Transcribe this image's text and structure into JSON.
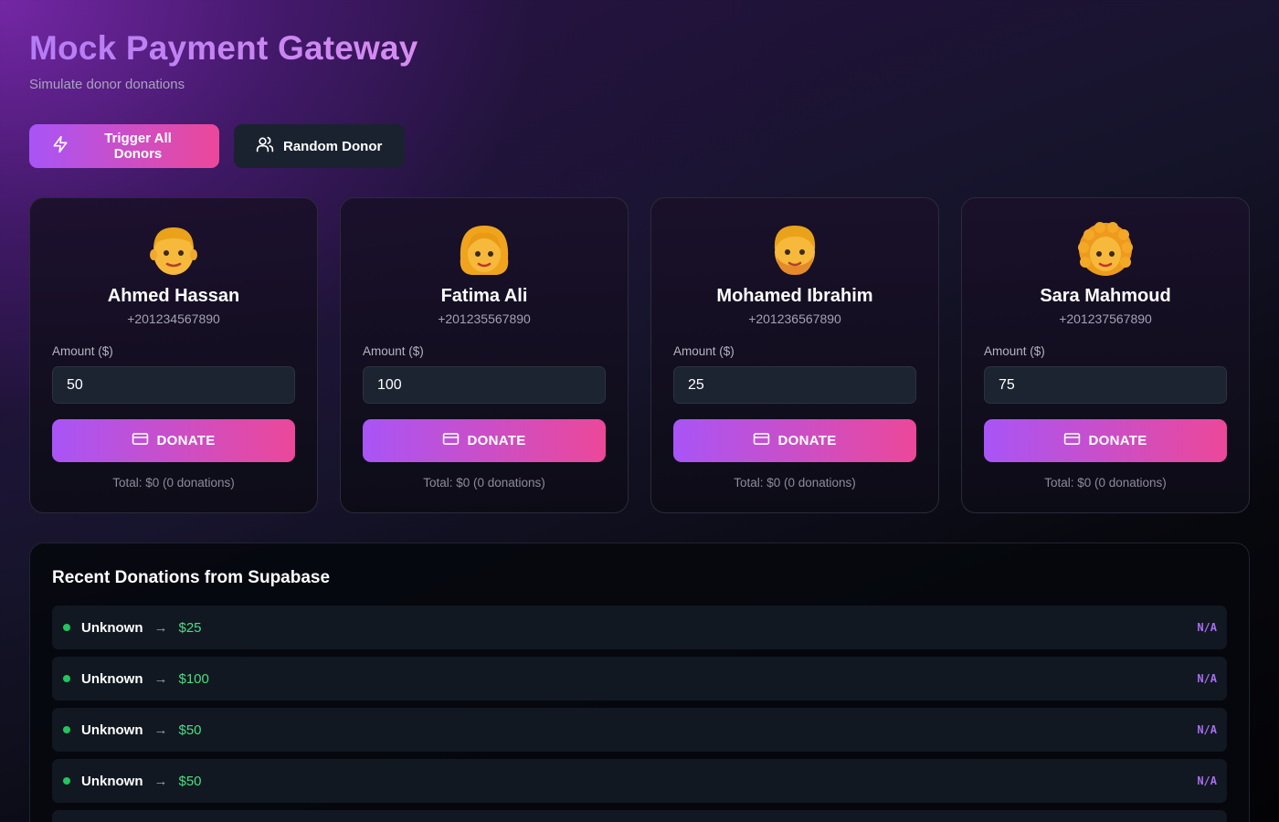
{
  "header": {
    "title": "Mock Payment Gateway",
    "subtitle": "Simulate donor donations"
  },
  "actions": {
    "trigger_all_label": "Trigger All Donors",
    "random_donor_label": "Random Donor"
  },
  "donors": [
    {
      "name": "Ahmed Hassan",
      "phone": "+201234567890",
      "amount_label": "Amount ($)",
      "amount": "50",
      "donate_label": "DONATE",
      "total": "Total: $0 (0 donations)",
      "avatar_icon": "man-emoji"
    },
    {
      "name": "Fatima Ali",
      "phone": "+201235567890",
      "amount_label": "Amount ($)",
      "amount": "100",
      "donate_label": "DONATE",
      "total": "Total: $0 (0 donations)",
      "avatar_icon": "woman-emoji"
    },
    {
      "name": "Mohamed Ibrahim",
      "phone": "+201236567890",
      "amount_label": "Amount ($)",
      "amount": "25",
      "donate_label": "DONATE",
      "total": "Total: $0 (0 donations)",
      "avatar_icon": "man-beard-emoji"
    },
    {
      "name": "Sara Mahmoud",
      "phone": "+201237567890",
      "amount_label": "Amount ($)",
      "amount": "75",
      "donate_label": "DONATE",
      "total": "Total: $0 (0 donations)",
      "avatar_icon": "woman-curly-hair-emoji"
    }
  ],
  "recent": {
    "title": "Recent Donations from Supabase",
    "rows": [
      {
        "name": "Unknown",
        "arrow": "→",
        "amount": "$25",
        "status": "N/A"
      },
      {
        "name": "Unknown",
        "arrow": "→",
        "amount": "$100",
        "status": "N/A"
      },
      {
        "name": "Unknown",
        "arrow": "→",
        "amount": "$50",
        "status": "N/A"
      },
      {
        "name": "Unknown",
        "arrow": "→",
        "amount": "$50",
        "status": "N/A"
      },
      {
        "name": "",
        "arrow": "",
        "amount": "",
        "status": ""
      }
    ]
  },
  "colors": {
    "accent_start": "#a855f7",
    "accent_end": "#ec4899",
    "success": "#22c55e",
    "status": "#a86ef2"
  }
}
